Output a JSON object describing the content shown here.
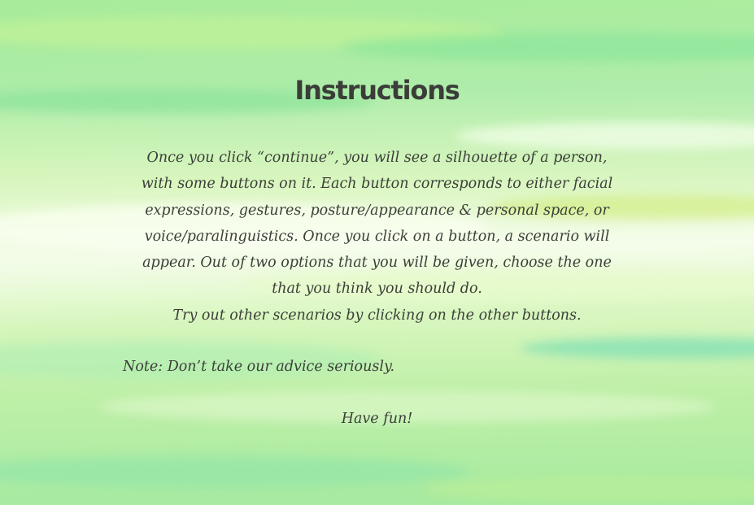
{
  "slide": {
    "title": "Instructions",
    "paragraph_lines": [
      "Once you click “continue”, you will see a silhouette of a person,",
      "with some buttons on it. Each button corresponds to either facial",
      "expressions, gestures, posture/appearance & personal space, or",
      "voice/paralinguistics. Once you click on a button, a scenario will",
      "appear. Out of two options that you will be given, choose the one",
      "that you think you should do.",
      "Try out other scenarios by clicking on the other buttons."
    ],
    "note": "Note: Don’t take our advice seriously.",
    "closing": "Have fun!"
  },
  "colors": {
    "text": "#3b3f39",
    "title": "#3a3d38",
    "background_base": "#b7ee9e",
    "background_light": "#e8fad2"
  }
}
